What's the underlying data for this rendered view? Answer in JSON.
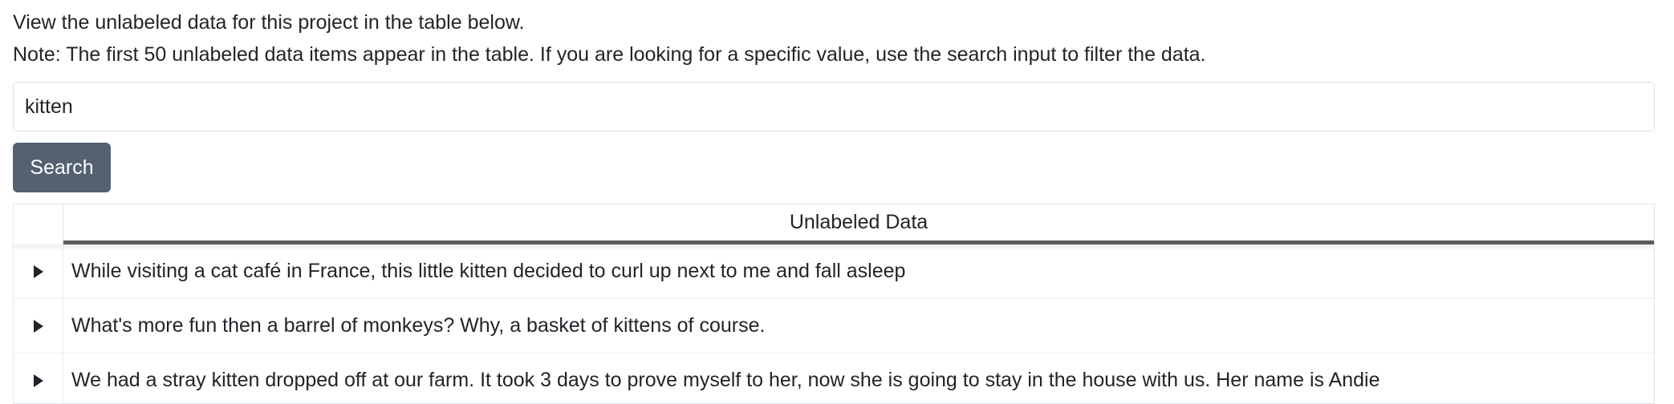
{
  "intro": {
    "line1": "View the unlabeled data for this project in the table below.",
    "line2": "Note: The first 50 unlabeled data items appear in the table. If you are looking for a specific value, use the search input to filter the data."
  },
  "search": {
    "value": "kitten",
    "button_label": "Search"
  },
  "table": {
    "header": "Unlabeled Data",
    "rows": [
      {
        "text": "While visiting a cat café in France, this little kitten decided to curl up next to me and fall asleep"
      },
      {
        "text": "What's more fun then a barrel of monkeys? Why, a basket of kittens of course."
      },
      {
        "text": "We had a stray kitten dropped off at our farm. It took 3 days to prove myself to her, now she is going to stay in the house with us. Her name is Andie"
      }
    ]
  },
  "colors": {
    "button_bg": "#536170",
    "header_underline": "#5c5c5c"
  },
  "icons": {
    "row_expand": "caret-right-icon"
  }
}
